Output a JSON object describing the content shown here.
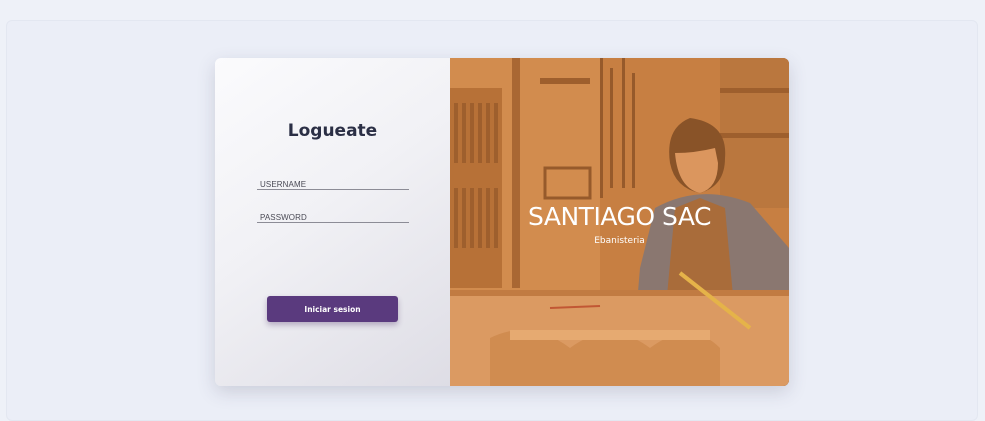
{
  "login": {
    "title": "Logueate",
    "username_placeholder": "USERNAME",
    "username_value": "",
    "password_placeholder": "PASSWORD",
    "password_value": "",
    "submit_label": "Iniciar sesion"
  },
  "brand": {
    "name": "SANTIAGO SAC",
    "tagline": "Ebanisteria",
    "image": "carpenter-workshop-photo"
  },
  "colors": {
    "page_background": "#eef1f8",
    "button": "#5a3a7e",
    "image_tint": "#e28e48",
    "title_text": "#2b2f45"
  }
}
